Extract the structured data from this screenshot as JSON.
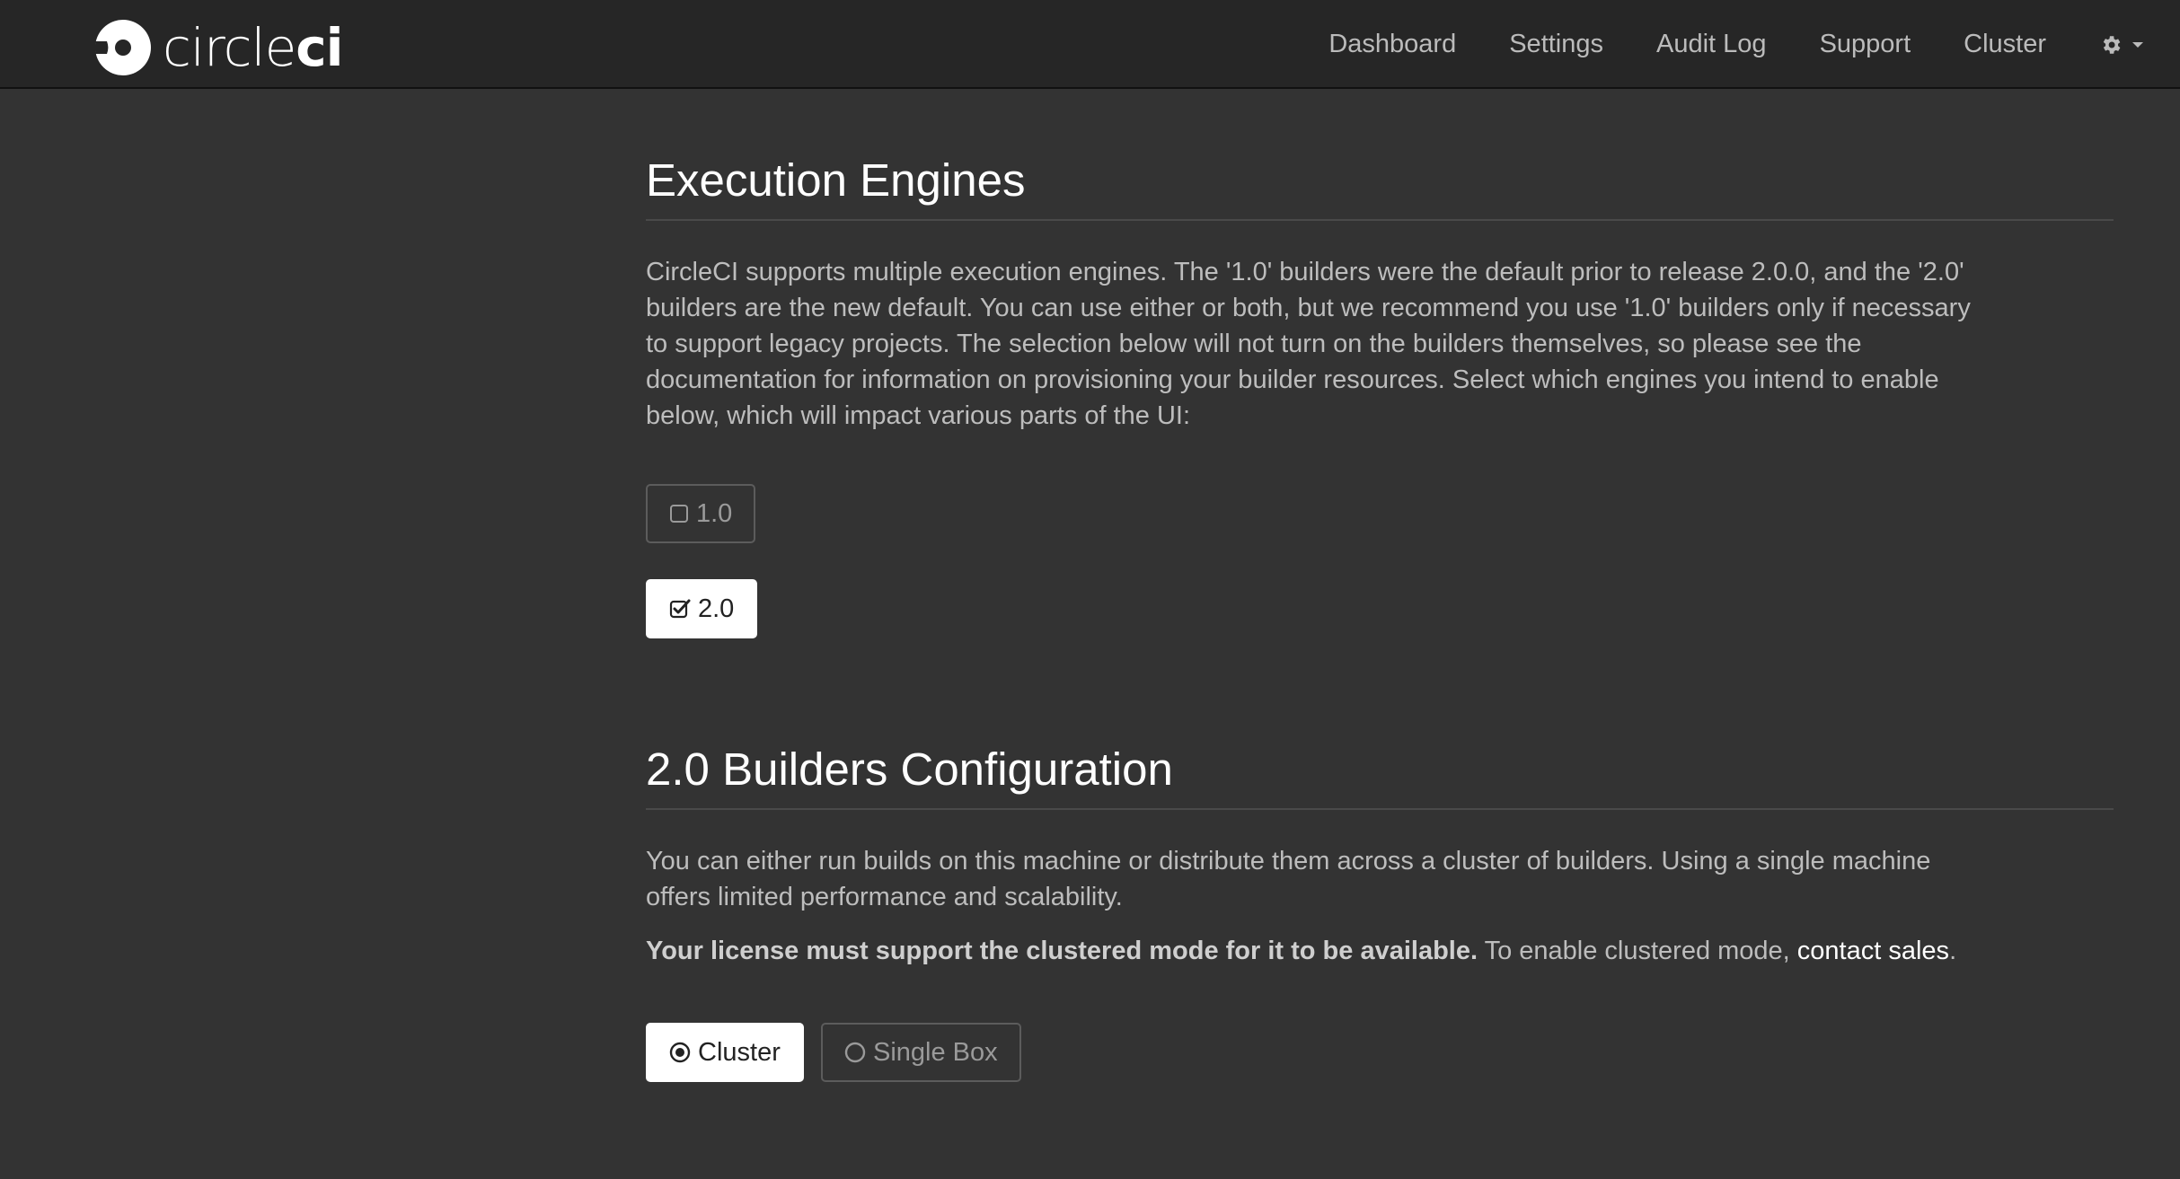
{
  "brand": {
    "name_part_1": "circle",
    "name_part_2": "ci",
    "logo_icon": "circleci-logo-icon"
  },
  "nav": {
    "items": [
      {
        "label": "Dashboard"
      },
      {
        "label": "Settings"
      },
      {
        "label": "Audit Log"
      },
      {
        "label": "Support"
      },
      {
        "label": "Cluster"
      }
    ],
    "settings_icon": "gear-icon",
    "settings_caret_icon": "caret-down-icon"
  },
  "execution_engines": {
    "title": "Execution Engines",
    "description": "CircleCI supports multiple execution engines. The '1.0' builders were the default prior to release 2.0.0, and the '2.0' builders are the new default. You can use either or both, but we recommend you use '1.0' builders only if necessary to support legacy projects. The selection below will not turn on the builders themselves, so please see the documentation for information on provisioning your builder resources. Select which engines you intend to enable below, which will impact various parts of the UI:",
    "options": [
      {
        "label": "1.0",
        "checked": false,
        "icon": "checkbox-unchecked-icon"
      },
      {
        "label": "2.0",
        "checked": true,
        "icon": "checkbox-checked-icon"
      }
    ]
  },
  "builders_config": {
    "title": "2.0 Builders Configuration",
    "description": "You can either run builds on this machine or distribute them across a cluster of builders. Using a single machine offers limited performance and scalability.",
    "license_note_bold": "Your license must support the clustered mode for it to be available.",
    "license_note_text": " To enable clustered mode, ",
    "license_note_link": "contact sales",
    "license_note_end": ".",
    "options": [
      {
        "label": "Cluster",
        "selected": true,
        "icon": "radio-selected-icon"
      },
      {
        "label": "Single Box",
        "selected": false,
        "icon": "radio-unselected-icon"
      }
    ]
  },
  "colors": {
    "navbar_bg": "#262626",
    "page_bg": "#333333",
    "text_muted": "#bdbdbd",
    "heading": "#ffffff"
  }
}
